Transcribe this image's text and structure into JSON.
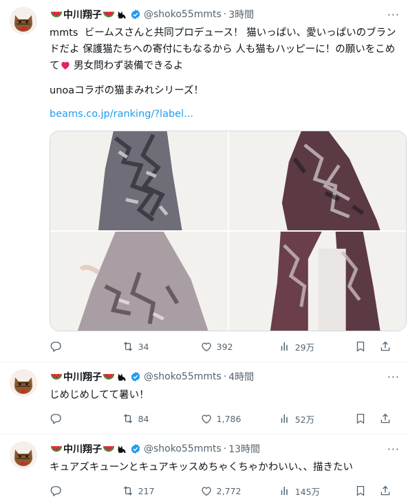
{
  "colors": {
    "accent": "#1d9bf0",
    "muted": "#536471",
    "text": "#0f1419",
    "border": "#eff3f4"
  },
  "tweets": [
    {
      "name": "中川翔子",
      "handle": "@shoko55mmts",
      "time": "3時間",
      "text": "mmts  ビームスさんと共同プロデュース！ 猫いっぱい、愛いっぱいのブランドだよ 保護猫たちへの寄付にもなるから 人も猫もハッピーに！の願いをこめて",
      "text_after_heart": " 男女問わず装備できるよ",
      "text2": "unoaコラボの猫まみれシリーズ！",
      "link": "beams.co.jp/ranking/?label...",
      "replies": "",
      "retweets": "34",
      "likes": "392",
      "views": "29万"
    },
    {
      "name": "中川翔子",
      "handle": "@shoko55mmts",
      "time": "4時間",
      "text": "じめじめしてて暑い！",
      "replies": "",
      "retweets": "84",
      "likes": "1,786",
      "views": "52万"
    },
    {
      "name": "中川翔子",
      "handle": "@shoko55mmts",
      "time": "13時間",
      "text": "キュアズキューンとキュアキッスめちゃくちゃかわいい、、描きたい",
      "replies": "",
      "retweets": "217",
      "likes": "2,772",
      "views": "145万"
    }
  ]
}
